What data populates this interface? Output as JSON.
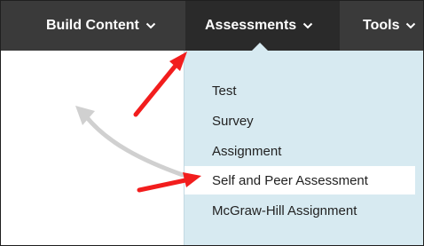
{
  "menubar": {
    "tabs": [
      {
        "label": "Build Content",
        "icon": "chevron-down-icon"
      },
      {
        "label": "Assessments",
        "icon": "chevron-down-icon",
        "active": true
      },
      {
        "label": "Tools",
        "icon": "chevron-down-icon"
      }
    ]
  },
  "dropdown": {
    "items": [
      {
        "label": "Test"
      },
      {
        "label": "Survey"
      },
      {
        "label": "Assignment"
      },
      {
        "label": "Self and Peer Assessment",
        "highlighted": true
      },
      {
        "label": "McGraw-Hill Assignment"
      }
    ]
  },
  "annotations": {
    "arrow_color": "#f21d1d",
    "curved_arrow_color": "#d0d0d0"
  },
  "colors": {
    "menubar_bg": "#3a3a3a",
    "active_tab_bg": "#2a2a2a",
    "dropdown_bg": "#d7eaf1",
    "highlight_bg": "#ffffff"
  }
}
